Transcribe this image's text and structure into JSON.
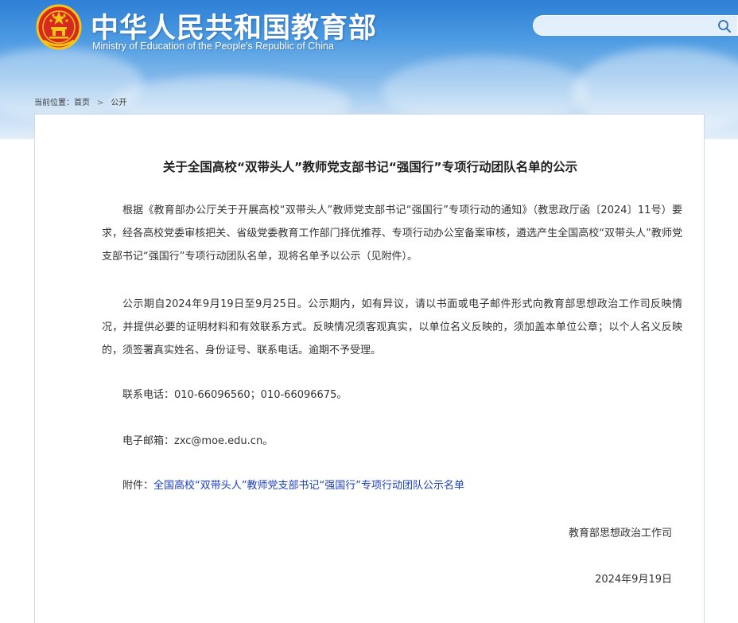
{
  "header": {
    "title_cn": "中华人民共和国教育部",
    "title_en": "Ministry of Education of the People's Republic of China",
    "emblem_icon": "national-emblem-icon",
    "colors": {
      "sky_top": "#2e7fd6",
      "sky_bottom": "#e3eefa",
      "emblem_red": "#d62a1e",
      "emblem_gold": "#f5c518"
    }
  },
  "search": {
    "placeholder": "",
    "value": "",
    "icon": "search-icon"
  },
  "breadcrumb": {
    "label": "当前位置：",
    "items": [
      "首页",
      "公开"
    ],
    "separator": ">"
  },
  "article": {
    "title": "关于全国高校“双带头人”教师党支部书记“强国行”专项行动团队名单的公示",
    "paragraphs": {
      "p1": "根据《教育部办公厅关于开展高校“双带头人”教师党支部书记“强国行”专项行动的通知》（教思政厅函〔2024〕11号）要求，经各高校党委审核把关、省级党委教育工作部门择优推荐、专项行动办公室备案审核，遴选产生全国高校“双带头人”教师党支部书记“强国行”专项行动团队名单，现将名单予以公示（见附件）。",
      "p2": "公示期自2024年9月19日至9月25日。公示期内，如有异议，请以书面或电子邮件形式向教育部思想政治工作司反映情况，并提供必要的证明材料和有效联系方式。反映情况须客观真实，以单位名义反映的，须加盖本单位公章；以个人名义反映的，须签署真实姓名、身份证号、联系电话。逾期不予受理。",
      "phone": "联系电话：010-66096560；010-66096675。",
      "email": "电子邮箱：zxc@moe.edu.cn。",
      "attachment_label": "附件：",
      "attachment_link": "全国高校“双带头人”教师党支部书记“强国行”专项行动团队公示名单"
    },
    "signature": {
      "org": "教育部思想政治工作司",
      "date": "2024年9月19日"
    },
    "link_color": "#1a3fbf"
  }
}
